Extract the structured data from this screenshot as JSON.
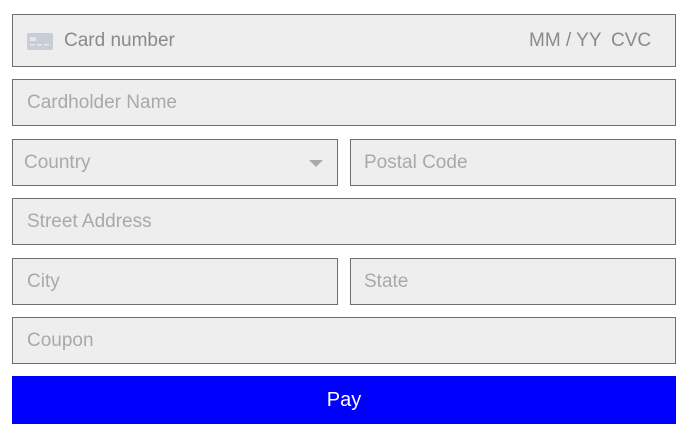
{
  "card": {
    "icon": "credit-card-icon",
    "number_placeholder": "Card number",
    "expiry_placeholder": "MM / YY",
    "cvc_placeholder": "CVC"
  },
  "cardholder_name": {
    "placeholder": "Cardholder Name"
  },
  "country": {
    "placeholder": "Country",
    "icon": "chevron-down-icon"
  },
  "postal_code": {
    "placeholder": "Postal Code"
  },
  "street_address": {
    "placeholder": "Street Address"
  },
  "city": {
    "placeholder": "City"
  },
  "state": {
    "placeholder": "State"
  },
  "coupon": {
    "placeholder": "Coupon"
  },
  "pay_button": {
    "label": "Pay"
  },
  "colors": {
    "field_background": "#eeeeee",
    "field_border": "#6e6e6e",
    "placeholder_text": "#a9a9a9",
    "pay_button_background": "#0000ff",
    "pay_button_text": "#ffffff"
  }
}
